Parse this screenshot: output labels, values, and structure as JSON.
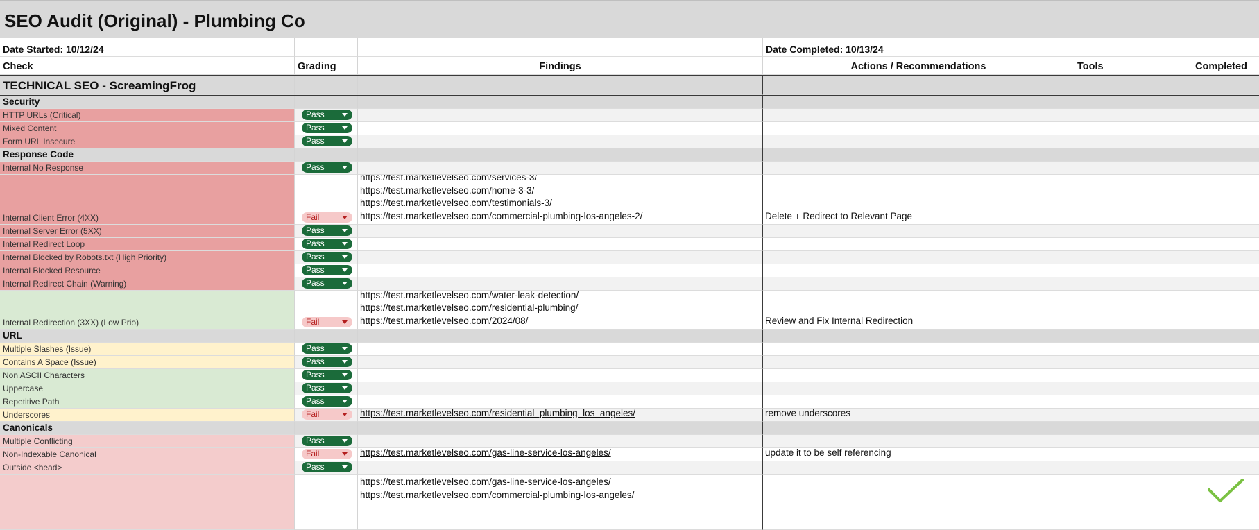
{
  "title": "SEO Audit (Original) - Plumbing Co",
  "date_started": "Date Started: 10/12/24",
  "date_completed": "Date Completed: 10/13/24",
  "headers": {
    "check": "Check",
    "grading": "Grading",
    "findings": "Findings",
    "actions": "Actions / Recommendations",
    "tools": "Tools",
    "completed": "Completed"
  },
  "section_title": "TECHNICAL SEO - ScreamingFrog",
  "categories": {
    "security": "Security",
    "response_code": "Response Code",
    "url": "URL",
    "canonicals": "Canonicals"
  },
  "grade_labels": {
    "pass": "Pass",
    "fail": "Fail"
  },
  "colors": {
    "title_bg": "#d9d9d9",
    "red_row": "#e8a0a0",
    "green_row": "#d9ead3",
    "yellow_row": "#fff2cc",
    "pink_row": "#f4cccc",
    "pass_pill": "#1b6b3a",
    "fail_pill": "#f6c9c9",
    "checkmark": "#7ac142"
  },
  "checks": {
    "http_urls": "HTTP URLs (Critical)",
    "mixed_content": "Mixed Content",
    "form_url_insecure": "Form URL Insecure",
    "internal_no_response": "Internal No Response",
    "internal_client_error": "Internal Client Error (4XX)",
    "internal_server_error": "Internal Server Error (5XX)",
    "internal_redirect_loop": "Internal Redirect Loop",
    "internal_blocked_robots": "Internal Blocked by Robots.txt (High Priority)",
    "internal_blocked_resource": "Internal Blocked Resource",
    "internal_redirect_chain": "Internal Redirect Chain (Warning)",
    "internal_redirection_3xx": "Internal Redirection (3XX) (Low Prio)",
    "multiple_slashes": "Multiple Slashes (Issue)",
    "contains_space": "Contains A Space  (Issue)",
    "non_ascii": "Non ASCII Characters",
    "uppercase": "Uppercase",
    "repetitive_path": "Repetitive Path",
    "underscores": "Underscores",
    "multiple_conflicting": "Multiple Conflicting",
    "non_indexable_canonical": "Non-Indexable Canonical",
    "outside_head": "Outside <head>"
  },
  "findings": {
    "client_error": "https://test.marketlevelseo.com/services-3/\nhttps://test.marketlevelseo.com/home-3-3/\nhttps://test.marketlevelseo.com/testimonials-3/\nhttps://test.marketlevelseo.com/commercial-plumbing-los-angeles-2/",
    "redirection": "https://test.marketlevelseo.com/water-leak-detection/\nhttps://test.marketlevelseo.com/residential-plumbing/\nhttps://test.marketlevelseo.com/2024/08/",
    "underscores": "https://test.marketlevelseo.com/residential_plumbing_los_angeles/",
    "non_indexable": "https://test.marketlevelseo.com/gas-line-service-los-angeles/",
    "last_row": "https://test.marketlevelseo.com/gas-line-service-los-angeles/\nhttps://test.marketlevelseo.com/commercial-plumbing-los-angeles/"
  },
  "actions": {
    "client_error": "Delete + Redirect to Relevant Page",
    "redirection": "Review and Fix Internal Redirection",
    "underscores": "remove underscores",
    "non_indexable": "update it to be self referencing"
  }
}
